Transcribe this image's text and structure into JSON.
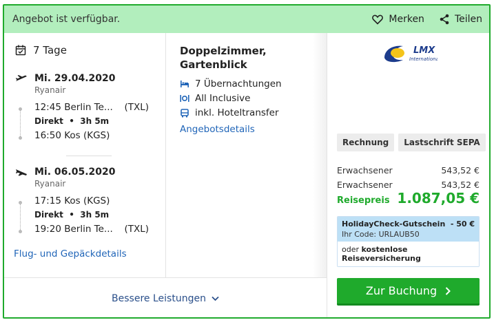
{
  "topbar": {
    "availability": "Angebot ist verfügbar.",
    "save_label": "Merken",
    "share_label": "Teilen"
  },
  "trip": {
    "duration": "7 Tage",
    "outbound": {
      "date": "Mi. 29.04.2020",
      "airline": "Ryanair",
      "depart_time_place": "12:45 Berlin Te...",
      "depart_code": "(TXL)",
      "direct_label": "Direkt",
      "flight_duration": "3h 5m",
      "arrive_time_place": "16:50 Kos (KGS)"
    },
    "inbound": {
      "date": "Mi. 06.05.2020",
      "airline": "Ryanair",
      "depart_time_place": "17:15 Kos (KGS)",
      "direct_label": "Direkt",
      "flight_duration": "3h 5m",
      "arrive_time_place": "19:20 Berlin Te...",
      "arrive_code": "(TXL)"
    },
    "flight_details_link": "Flug- und Gepäckdetails"
  },
  "room": {
    "name_line1": "Doppelzimmer,",
    "name_line2": "Gartenblick",
    "features": [
      "7 Übernachtungen",
      "All Inclusive",
      "inkl. Hoteltransfer"
    ],
    "details_link": "Angebotsdetails"
  },
  "better_services": "Bessere Leistungen",
  "operator": {
    "logo_text": "LMX",
    "logo_subtext": "International"
  },
  "payment": [
    "Rechnung",
    "Lastschrift SEPA"
  ],
  "prices": {
    "rows": [
      {
        "label": "Erwachsener",
        "amount": "543,52 €"
      },
      {
        "label": "Erwachsener",
        "amount": "543,52 €"
      }
    ],
    "total_label": "Reisepreis",
    "total_amount": "1.087,05 €"
  },
  "voucher": {
    "title": "HolidayCheck-Gutschein",
    "discount": "- 50 €",
    "code_text": "Ihr Code: URLAUB50",
    "insurance_prefix": "oder ",
    "insurance_bold": "kostenlose Reiseversicherung"
  },
  "booking_button": "Zur Buchung",
  "colors": {
    "accent_green": "#1faa2c",
    "banner_green": "#b2eebd",
    "link_blue": "#2065b8",
    "voucher_blue": "#bde0f6"
  }
}
